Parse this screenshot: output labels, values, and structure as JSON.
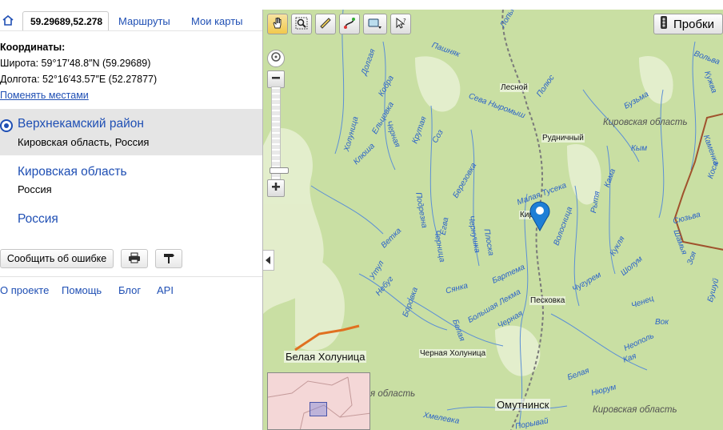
{
  "tabs": {
    "home_icon": "home-icon",
    "coordinates_value": "59.29689,52.278",
    "routes": "Маршруты",
    "my_maps": "Мои карты"
  },
  "coords": {
    "title": "Координаты:",
    "latitude": "Широта: 59°17′48.8″N (59.29689)",
    "longitude": "Долгота: 52°16′43.57″E (52.27877)",
    "swap": "Поменять местами"
  },
  "results": [
    {
      "name": "Верхнекамский район",
      "sub": "Кировская область, Россия",
      "selected": true
    },
    {
      "name": "Кировская область",
      "sub": "Россия",
      "selected": false
    },
    {
      "name": "Россия",
      "sub": "",
      "selected": false
    }
  ],
  "actions": {
    "report": "Сообщить об ошибке",
    "print_icon": "printer-icon",
    "pin_icon": "signpost-icon"
  },
  "footer": {
    "about": "О проекте",
    "help": "Помощь",
    "blog": "Блог",
    "api": "API"
  },
  "map": {
    "traffic": "Пробки",
    "tools": [
      "hand-icon",
      "magnifier-icon",
      "ruler-icon",
      "route-icon",
      "layers-icon",
      "pointer-help-icon"
    ],
    "labels": {
      "towns": {
        "lesnoy": "Лесной",
        "rudnichny": "Рудничный",
        "kirs": "Кир",
        "peskovka": "Песковка",
        "chernaya_kholunitsa": "Черная Холуница"
      },
      "big_towns": {
        "belaya_kholunitsa": "Белая Холуница",
        "omutninsk": "Омутнинск"
      },
      "regions": {
        "kirov_region_ne": "Кировская область",
        "kirov_region_sw": "я область",
        "kirov_region_se": "Кировская область"
      },
      "rivers": {
        "pashnyak": "Пашняк",
        "lopya": "Лопья",
        "polyus": "Полюс",
        "dolgaya": "Долгая",
        "kobra": "Кобра",
        "seva_nyrmysh": "Сева Ныромыш",
        "eltsovka": "Ельцовка",
        "chernaya_1": "Черная",
        "krutaya": "Крутая",
        "soz": "Соз",
        "klyusha": "Клюша",
        "kholunitsa": "Холуница",
        "berezovka": "Березовка",
        "malaya_tuseka": "Малая Тусека",
        "kama": "Кама",
        "kym": "Кым",
        "vetka": "Ветка",
        "podrezna": "Подрезна",
        "egva": "Егва",
        "chernitsa": "Черница",
        "chernushka": "Чернушка",
        "ploska": "Плоска",
        "utul": "Утул",
        "nebug": "Небуг",
        "bartema": "Бартема",
        "volodshcha": "Волосница",
        "rytya": "Рытя",
        "kuzma": "Бузьма",
        "kulya": "Кукля",
        "borovka": "Боровка",
        "syanka": "Сянка",
        "bolshaya_lekma": "Большая Лекма",
        "chernaya_2": "Черная",
        "belaya": "Белая",
        "chetyrem": "Чугурем",
        "shalum": "Шолум",
        "chenets": "Ченец",
        "vok": "Вок",
        "neopol": "Неополь",
        "kaya": "Кая",
        "nyrum": "Нюрум",
        "belaya_2": "Белая",
        "volva": "Вольва",
        "kuzha": "Кужва",
        "kamenka": "Каменка",
        "kosa": "Коса",
        "syuzva": "Сюзьва",
        "shamya": "Шамья",
        "zoya": "Зоя",
        "buzhy": "Бушуй",
        "khmelevka": "Хмелевка",
        "poryvay": "Порывай"
      }
    }
  }
}
